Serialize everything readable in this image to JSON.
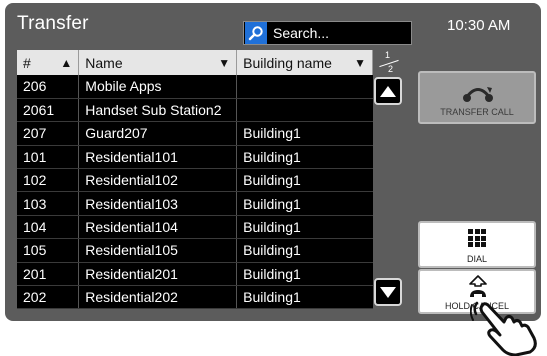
{
  "header": {
    "title": "Transfer",
    "search_placeholder": "Search...",
    "time": "10:30 AM"
  },
  "table": {
    "columns": [
      {
        "label": "#",
        "sort": "asc"
      },
      {
        "label": "Name",
        "sort": "desc"
      },
      {
        "label": "Building name",
        "sort": "desc"
      }
    ],
    "rows": [
      {
        "num": "206",
        "name": "Mobile Apps",
        "building": ""
      },
      {
        "num": "2061",
        "name": "Handset Sub Station2",
        "building": ""
      },
      {
        "num": "207",
        "name": "Guard207",
        "building": "Building1"
      },
      {
        "num": "101",
        "name": "Residential101",
        "building": "Building1"
      },
      {
        "num": "102",
        "name": "Residential102",
        "building": "Building1"
      },
      {
        "num": "103",
        "name": "Residential103",
        "building": "Building1"
      },
      {
        "num": "104",
        "name": "Residential104",
        "building": "Building1"
      },
      {
        "num": "105",
        "name": "Residential105",
        "building": "Building1"
      },
      {
        "num": "201",
        "name": "Residential201",
        "building": "Building1"
      },
      {
        "num": "202",
        "name": "Residential202",
        "building": "Building1"
      }
    ]
  },
  "pager": {
    "current": "1",
    "total": "2"
  },
  "buttons": {
    "transfer_call": "TRANSFER CALL",
    "dial": "DIAL",
    "hold_cancel": "HOLD CANCEL"
  },
  "icons": {
    "search": "search-icon",
    "scroll_up": "triangle-up-icon",
    "scroll_down": "triangle-down-icon",
    "transfer": "transfer-call-icon",
    "dial": "keypad-icon",
    "hold": "hold-cancel-icon",
    "pointer": "pointing-hand-icon"
  },
  "colors": {
    "panel": "#5c5c5c",
    "search_icon_bg": "#1f70d8",
    "list_bg": "#000000",
    "header_bg": "#e6e6e6"
  }
}
